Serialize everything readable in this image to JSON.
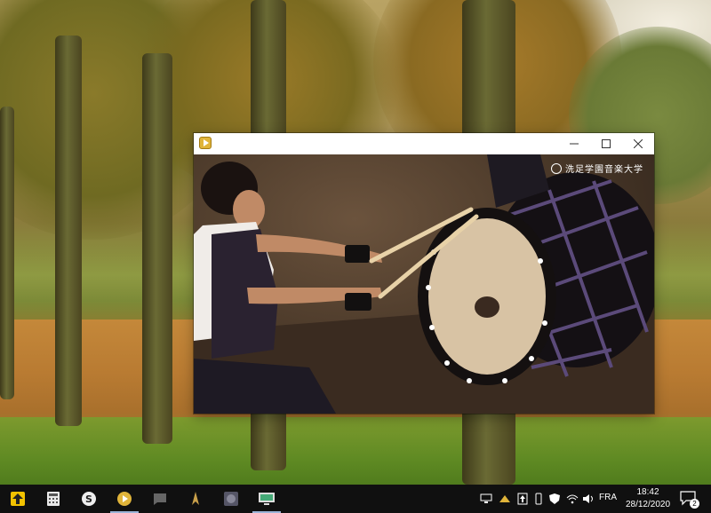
{
  "window": {
    "title": "",
    "video_watermark": "洗足学園音楽大学"
  },
  "taskbar": {
    "pinned_apps": [
      {
        "name": "upload-app-icon"
      },
      {
        "name": "calculator-app-icon"
      },
      {
        "name": "spotify-style-app-icon"
      },
      {
        "name": "media-player-app-icon"
      },
      {
        "name": "chat-app-icon"
      },
      {
        "name": "game-app-icon"
      },
      {
        "name": "photo-app-icon"
      },
      {
        "name": "screen-app-icon"
      }
    ],
    "tray": {
      "language": "FRA",
      "time": "18:42",
      "date": "28/12/2020",
      "notification_count": "2"
    }
  },
  "colors": {
    "taskbar_bg": "#101010",
    "titlebar_bg": "#ffffff",
    "app_icon": "#e0b43a"
  }
}
